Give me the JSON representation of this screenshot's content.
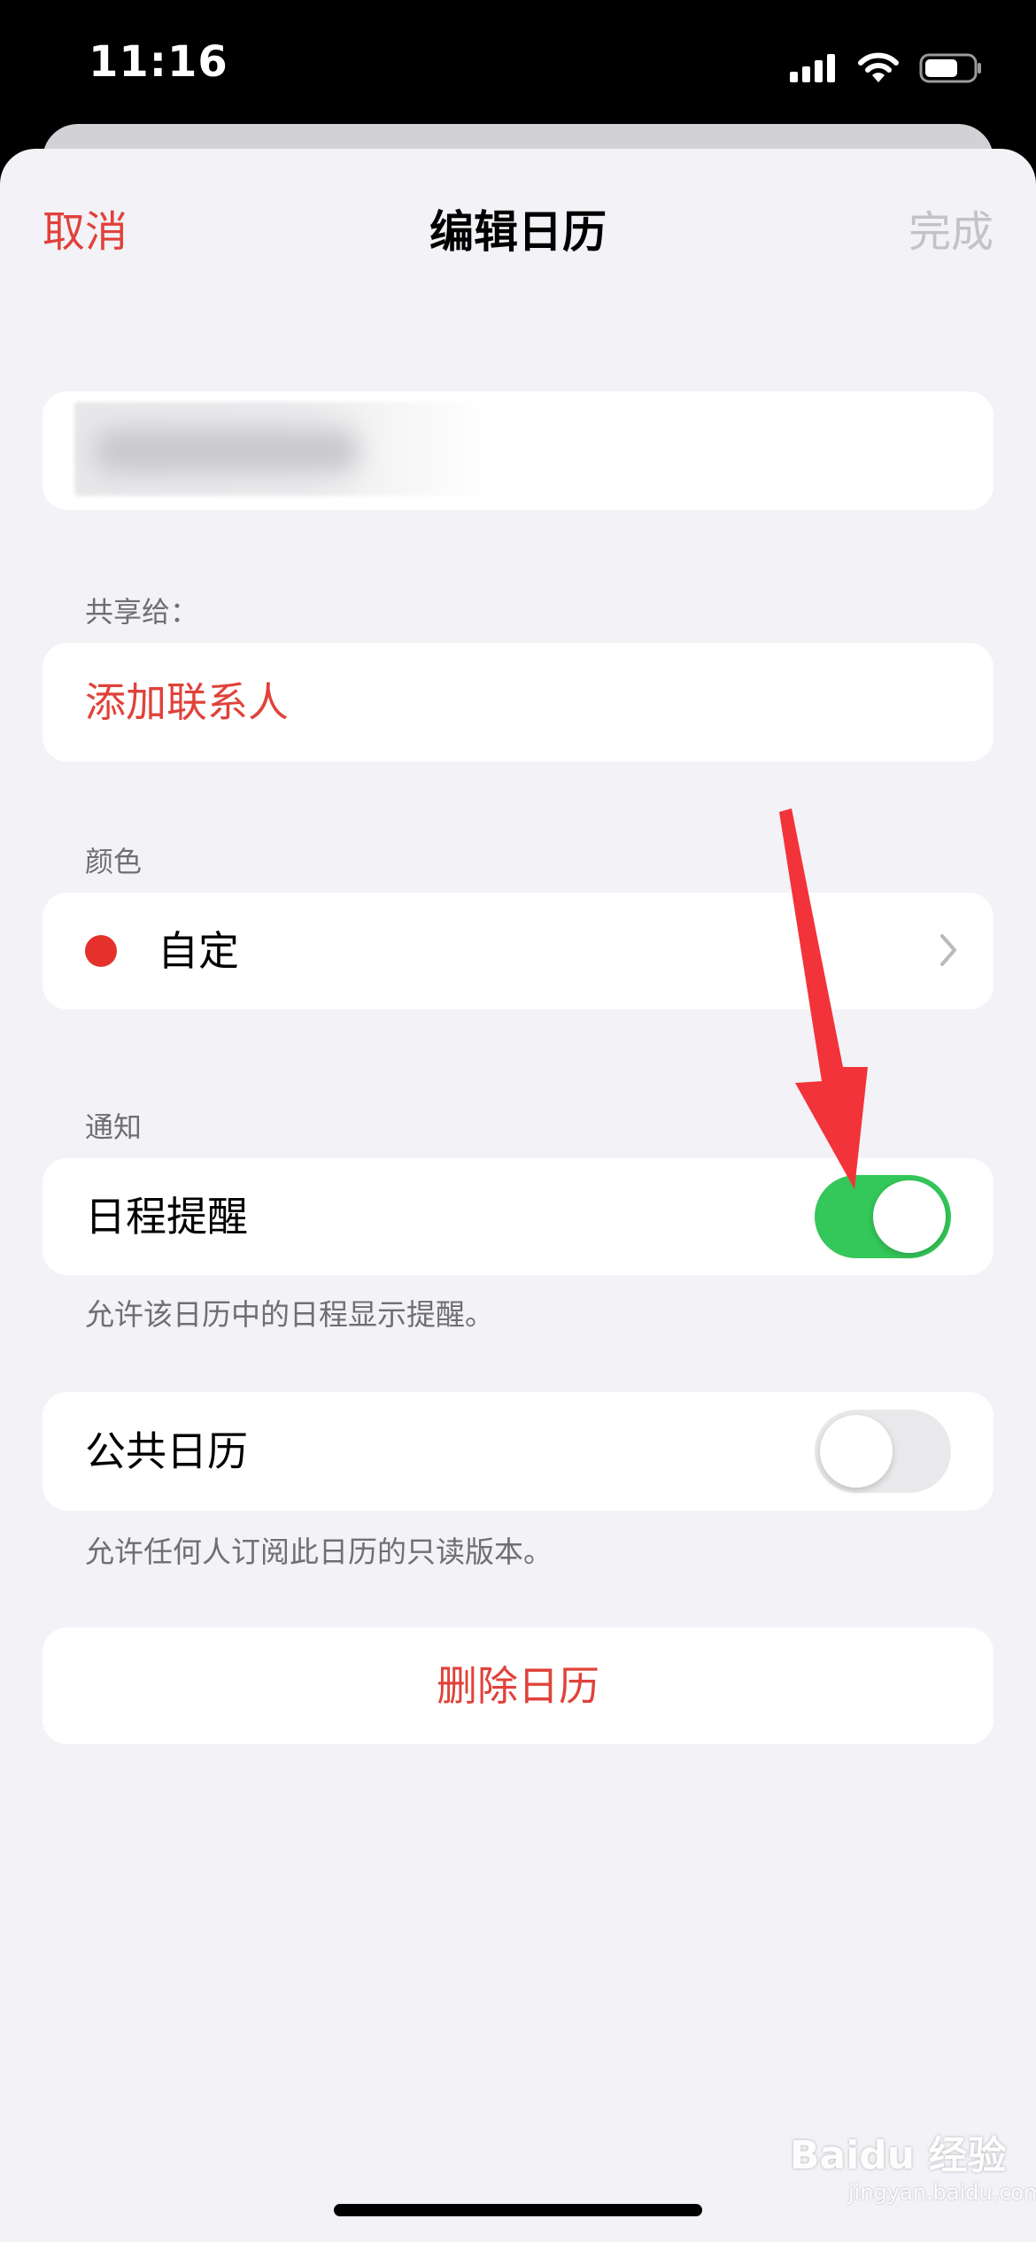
{
  "status_bar": {
    "time": "11:16"
  },
  "nav": {
    "cancel": "取消",
    "title": "编辑日历",
    "done": "完成"
  },
  "sharing": {
    "header": "共享给：",
    "add_contact": "添加联系人"
  },
  "color": {
    "header": "颜色",
    "value": "自定",
    "dot_color": "#e5312c"
  },
  "notifications": {
    "header": "通知",
    "event_alerts_label": "日程提醒",
    "event_alerts_on": true,
    "event_alerts_footer": "允许该日历中的日程显示提醒。"
  },
  "public_calendar": {
    "label": "公共日历",
    "on": false,
    "footer": "允许任何人订阅此日历的只读版本。"
  },
  "delete": {
    "label": "删除日历"
  },
  "watermark": {
    "brand": "Baidu 经验",
    "url": "jingyan.baidu.com"
  },
  "colors": {
    "accent_red": "#e0423a",
    "toggle_on": "#34c759",
    "background": "#f2f2f7"
  }
}
